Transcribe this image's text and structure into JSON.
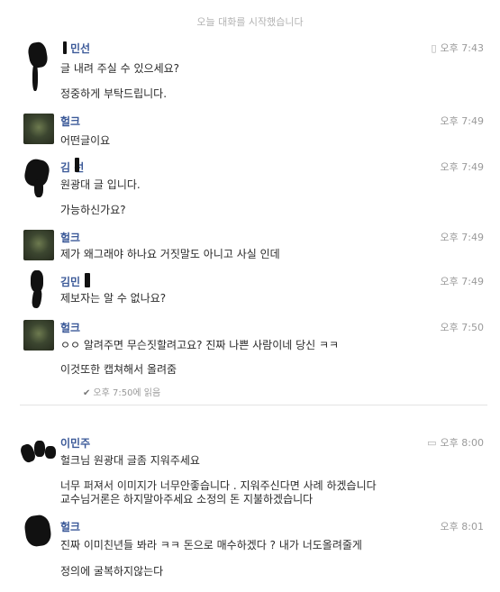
{
  "system_notice": "오늘 대화를 시작했습니다",
  "messages": [
    {
      "sender": "민선",
      "time": "오후 7:43",
      "lines": [
        "글 내려 주실 수 있으세요?",
        "정중하게 부탁드립니다."
      ],
      "icon": "phone-icon"
    },
    {
      "sender": "헐크",
      "time": "오후 7:49",
      "lines": [
        "어떤글이요"
      ]
    },
    {
      "sender": "김 선",
      "time": "오후 7:49",
      "lines": [
        "원광대 글 입니다.",
        "가능하신가요?"
      ]
    },
    {
      "sender": "헐크",
      "time": "오후 7:49",
      "lines": [
        "제가 왜그래야 하나요 거짓말도 아니고 사실 인데"
      ]
    },
    {
      "sender": "김민",
      "time": "오후 7:49",
      "lines": [
        "제보자는 알 수 없나요?"
      ]
    },
    {
      "sender": "헐크",
      "time": "오후 7:50",
      "lines": [
        "ㅇㅇ 알려주면 무슨짓할려고요? 진짜 나쁜 사람이네 당신 ㅋㅋ",
        "이것또한 캡쳐해서 올려줌"
      ],
      "read": "오후 7:50에 읽음"
    },
    {
      "sender": "이민주",
      "time": "오후 8:00",
      "lines": [
        "헐크님 원광대 글좀 지워주세요",
        "너무 퍼져서 이미지가 너무안좋습니다 . 지워주신다면 사례 하겠습니다",
        "교수님거론은 하지말아주세요  소정의 돈 지불하겠습니다"
      ],
      "icon": "chat-bubble-icon"
    },
    {
      "sender": "헐크",
      "time": "오후 8:01",
      "lines": [
        "진짜 이미친년들 봐라 ㅋㅋ 돈으로 매수하겠다 ? 내가 너도올려줄게",
        "정의에 굴복하지않는다"
      ]
    }
  ]
}
